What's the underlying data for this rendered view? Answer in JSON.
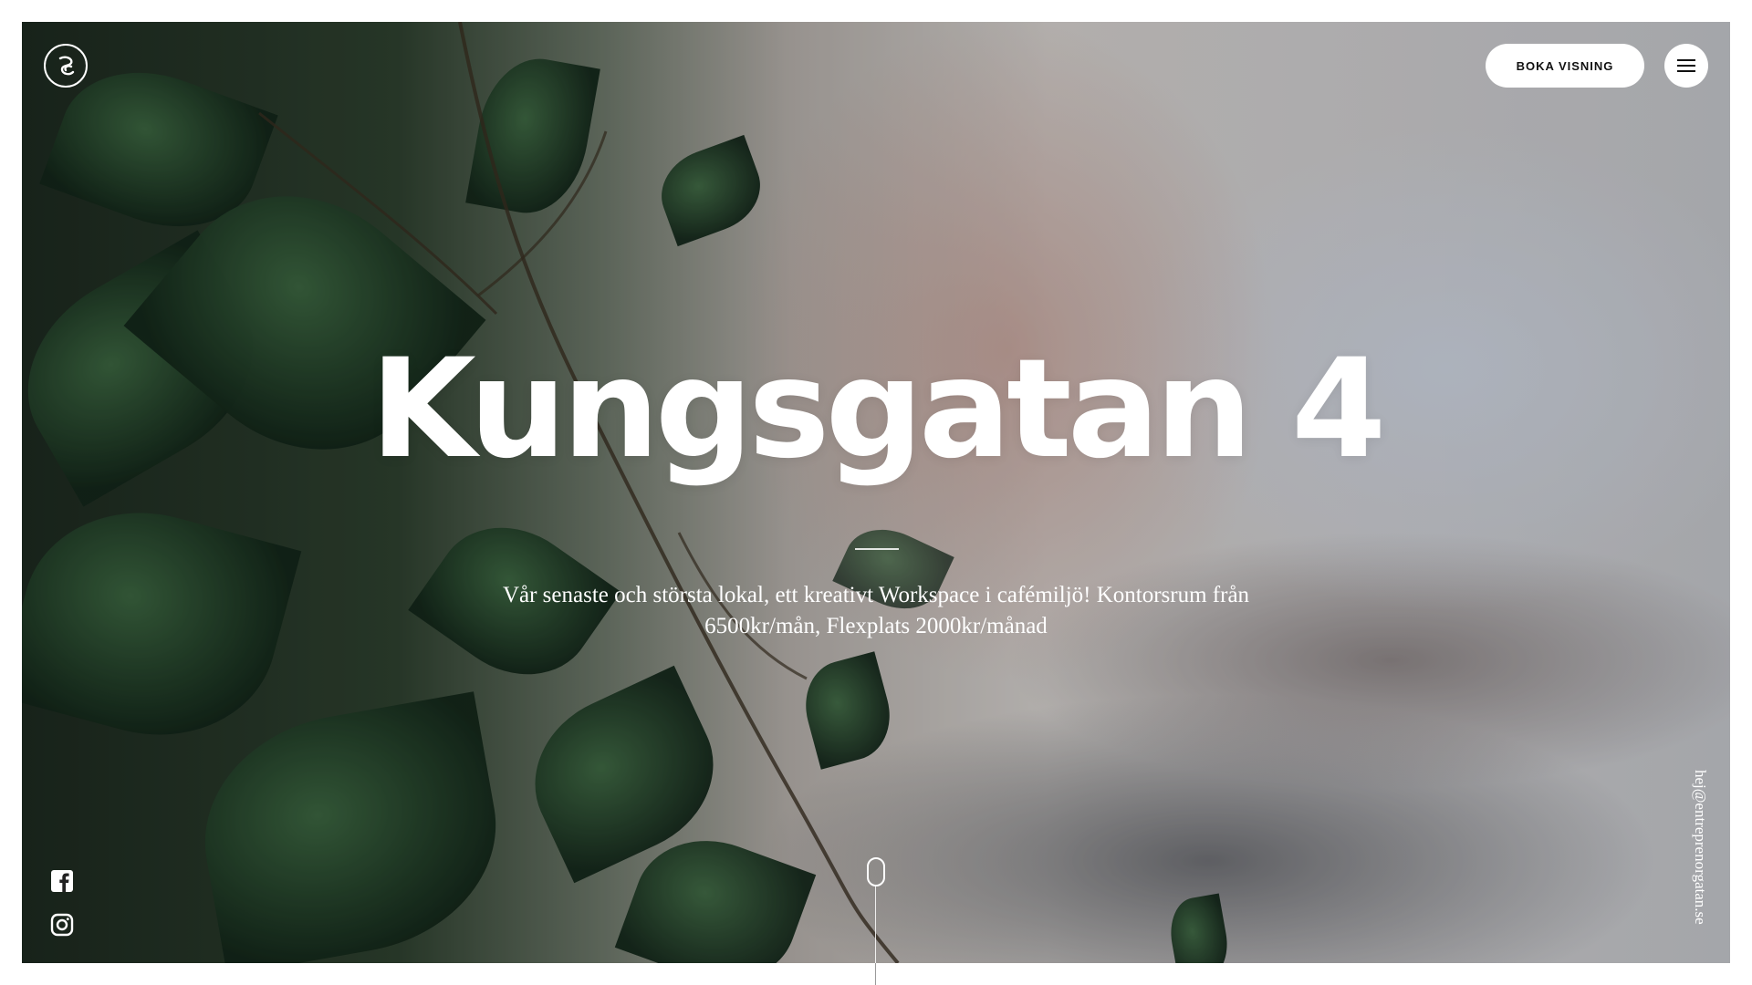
{
  "header": {
    "logo_icon": "entreprenorgatan-logo-icon",
    "book_label": "BOKA VISNING",
    "menu_icon": "hamburger-menu-icon"
  },
  "hero": {
    "title": "Kungsgatan 4",
    "subtitle": "Vår senaste och största lokal, ett kreativt Workspace i cafémiljö! Kontorsrum från 6500kr/mån, Flexplats 2000kr/månad",
    "scroll_icon": "scroll-mouse-icon"
  },
  "social": {
    "facebook_icon": "facebook-icon",
    "instagram_icon": "instagram-icon"
  },
  "contact": {
    "email": "hej@entreprenorgatan.se"
  },
  "colors": {
    "text": "#ffffff",
    "button_bg": "#ffffff",
    "button_text": "#111111",
    "page_bg": "#ffffff"
  }
}
